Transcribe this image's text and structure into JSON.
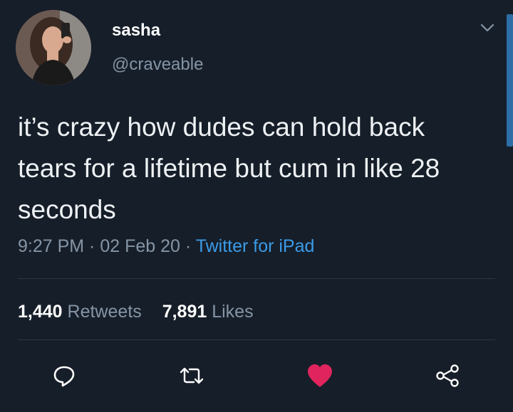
{
  "author": {
    "name": "sasha",
    "handle": "@craveable"
  },
  "tweet": {
    "text": "it’s crazy how dudes can hold back tears for a lifetime but cum in like 28 seconds",
    "time": "9:27 PM",
    "date": "02 Feb 20",
    "separator": " · ",
    "source": "Twitter for iPad"
  },
  "stats": {
    "retweets_count": "1,440",
    "retweets_label": "Retweets",
    "likes_count": "7,891",
    "likes_label": "Likes"
  },
  "actions": {
    "reply_icon": "comment-bubble",
    "retweet_icon": "retweet-arrows",
    "like_icon": "heart-filled",
    "share_icon": "share-nodes"
  },
  "colors": {
    "background": "#161e29",
    "link": "#3b9be8",
    "like": "#e0245e",
    "muted": "#8595a6"
  }
}
